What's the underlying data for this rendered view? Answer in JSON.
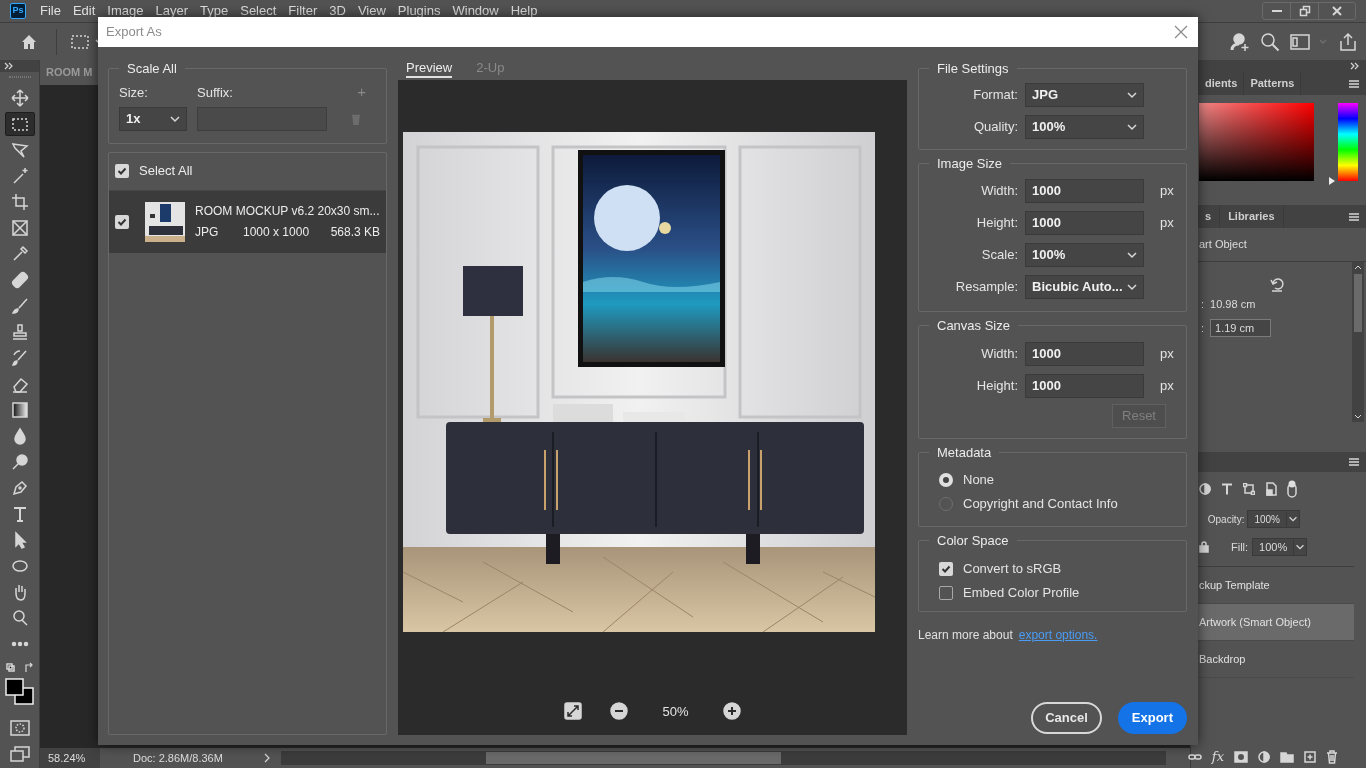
{
  "app_logo": "Ps",
  "menu_bar": [
    "File",
    "Edit",
    "Image",
    "Layer",
    "Type",
    "Select",
    "Filter",
    "3D",
    "View",
    "Plugins",
    "Window",
    "Help"
  ],
  "document_tab": "ROOM M",
  "tools": [
    {
      "selected": false
    },
    {
      "selected": true
    },
    {
      "selected": false
    },
    {
      "selected": false
    },
    {
      "selected": false
    },
    {
      "selected": false
    },
    {
      "selected": false
    },
    {
      "selected": false
    },
    {
      "selected": false
    },
    {
      "selected": false
    },
    {
      "selected": false
    },
    {
      "selected": false
    },
    {
      "selected": false
    },
    {
      "selected": false
    },
    {
      "selected": false
    },
    {
      "selected": false
    },
    {
      "selected": false
    },
    {
      "selected": false
    },
    {
      "selected": false
    },
    {
      "selected": false
    },
    {
      "selected": false
    },
    {
      "selected": false
    }
  ],
  "status_bar": {
    "zoom": "58.24%",
    "document": "Doc: 2.86M/8.36M"
  },
  "panels": {
    "swatch_tabs": [
      "dients",
      "Patterns"
    ],
    "hue_slider": {
      "level": 0
    },
    "properties_tabs": [
      "s",
      "Libraries"
    ],
    "properties_title": "art Object",
    "properties_fields": [
      {
        "kind": "text",
        "label": ":",
        "value": "10.98 cm"
      },
      {
        "kind": "input",
        "label": ":",
        "value": "1.19 cm"
      }
    ],
    "layers": {
      "opacity_label": "Opacity:",
      "opacity": "100%",
      "fill_label": "Fill:",
      "fill": "100%",
      "items": [
        {
          "name": "ckup Template",
          "selected": false
        },
        {
          "name": "Artwork (Smart Object)",
          "selected": true
        },
        {
          "name": "Backdrop",
          "selected": false
        }
      ],
      "fx_label": "fx"
    }
  },
  "dialog": {
    "title": "Export As",
    "scale_all": {
      "title": "Scale All",
      "size_label": "Size:",
      "suffix_label": "Suffix:",
      "size_value": "1x",
      "add_symbol": "+"
    },
    "select_all": {
      "label": "Select All",
      "checked": true
    },
    "files": [
      {
        "name": "ROOM MOCKUP v6.2 20x30 sm...",
        "format": "JPG",
        "dimensions": "1000 x 1000",
        "file_size": "568.3 KB",
        "checked": true,
        "selected": true
      }
    ],
    "preview_tabs": [
      {
        "label": "Preview",
        "selected": true
      },
      {
        "label": "2-Up",
        "selected": false
      }
    ],
    "zoom": "50%",
    "file_settings": {
      "title": "File Settings",
      "fields": [
        {
          "kind": "select",
          "label": "Format:",
          "value": "JPG"
        },
        {
          "kind": "select",
          "label": "Quality:",
          "value": "100%"
        }
      ]
    },
    "image_size": {
      "title": "Image Size",
      "fields": [
        {
          "kind": "input",
          "label": "Width:",
          "value": "1000",
          "unit": "px"
        },
        {
          "kind": "input",
          "label": "Height:",
          "value": "1000",
          "unit": "px"
        },
        {
          "kind": "select",
          "label": "Scale:",
          "value": "100%"
        },
        {
          "kind": "select",
          "label": "Resample:",
          "value": "Bicubic Auto..."
        }
      ]
    },
    "canvas_size": {
      "title": "Canvas Size",
      "fields": [
        {
          "kind": "input",
          "label": "Width:",
          "value": "1000",
          "unit": "px"
        },
        {
          "kind": "input",
          "label": "Height:",
          "value": "1000",
          "unit": "px"
        }
      ],
      "reset": {
        "label": "Reset",
        "disabled": true
      }
    },
    "metadata": {
      "title": "Metadata",
      "options": [
        {
          "label": "None",
          "selected": true
        },
        {
          "label": "Copyright and Contact Info",
          "selected": false
        }
      ]
    },
    "color_space": {
      "title": "Color Space",
      "options": [
        {
          "label": "Convert to sRGB",
          "checked": true
        },
        {
          "label": "Embed Color Profile",
          "checked": false
        }
      ]
    },
    "learn_more": {
      "text": "Learn more about",
      "link": "export options."
    },
    "buttons": {
      "cancel": "Cancel",
      "export": "Export"
    }
  }
}
